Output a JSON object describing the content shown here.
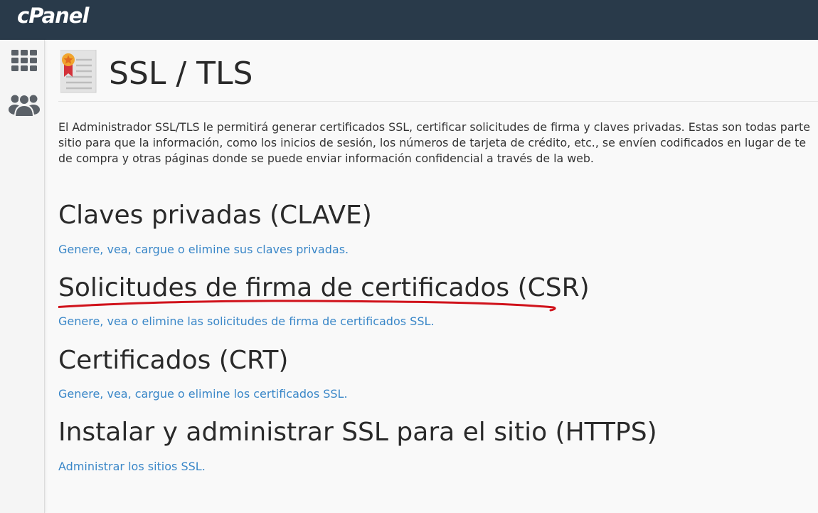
{
  "header": {
    "logo": "cPanel"
  },
  "page": {
    "title": "SSL / TLS",
    "description": [
      "El Administrador SSL/TLS le permitirá generar certificados SSL, certificar solicitudes de firma y claves privadas. Estas son todas parte",
      "sitio para que la información, como los inicios de sesión, los números de tarjeta de crédito, etc., se envíen codificados en lugar de te",
      "de compra y otras páginas donde se puede enviar información confidencial a través de la web."
    ]
  },
  "sections": [
    {
      "title": "Claves privadas (CLAVE)",
      "link": "Genere, vea, cargue o elimine sus claves privadas."
    },
    {
      "title": "Solicitudes de firma de certificados (CSR)",
      "link": "Genere, vea o elimine las solicitudes de firma de certificados SSL."
    },
    {
      "title": "Certificados (CRT)",
      "link": "Genere, vea, cargue o elimine los certificados SSL."
    },
    {
      "title": "Instalar y administrar SSL para el sitio (HTTPS)",
      "link": "Administrar los sitios SSL."
    }
  ],
  "colors": {
    "topbar": "#293a4a",
    "link": "#3a87c8",
    "annotation": "#d0121b"
  }
}
